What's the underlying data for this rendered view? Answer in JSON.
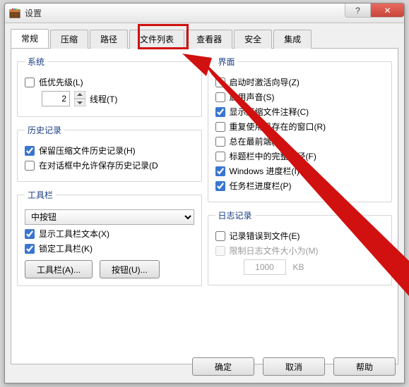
{
  "window": {
    "title": "设置"
  },
  "tabs": {
    "items": [
      "常规",
      "压缩",
      "路径",
      "文件列表",
      "查看器",
      "安全",
      "集成"
    ],
    "selected_index": 0,
    "highlight_index": 3
  },
  "left": {
    "system": {
      "legend": "系统",
      "low_priority": {
        "label": "低优先级(L)",
        "checked": false
      },
      "threads": {
        "label": "线程(T)",
        "value": "2"
      }
    },
    "history": {
      "legend": "历史记录",
      "keep_archive_history": {
        "label": "保留压缩文件历史记录(H)",
        "checked": true
      },
      "allow_dialog_history": {
        "label": "在对话框中允许保存历史记录(D",
        "checked": false
      }
    },
    "toolbar": {
      "legend": "工具栏",
      "size_select": {
        "selected": "中按钮"
      },
      "show_text": {
        "label": "显示工具栏文本(X)",
        "checked": true
      },
      "lock_toolbar": {
        "label": "锁定工具栏(K)",
        "checked": true
      },
      "toolbar_btn": "工具栏(A)...",
      "buttons_btn": "按钮(U)..."
    }
  },
  "right": {
    "interface": {
      "legend": "界面",
      "activate_wizard": {
        "label": "启动时激活向导(Z)",
        "checked": false
      },
      "enable_sound": {
        "label": "启用声音(S)",
        "checked": false
      },
      "show_comment": {
        "label": "显示压缩文件注释(C)",
        "checked": true
      },
      "reuse_window": {
        "label": "重复使用已存在的窗口(R)",
        "checked": false
      },
      "always_on_top": {
        "label": "总在最前端(W)",
        "checked": false
      },
      "full_path_title": {
        "label": "标题栏中的完整路径(F)",
        "checked": false
      },
      "windows_progress": {
        "label": "Windows 进度栏(I)",
        "checked": true
      },
      "taskbar_progress": {
        "label": "任务栏进度栏(P)",
        "checked": true
      }
    },
    "log": {
      "legend": "日志记录",
      "log_errors": {
        "label": "记录错误到文件(E)",
        "checked": false
      },
      "limit_log": {
        "label": "限制日志文件大小为(M)",
        "checked": false,
        "disabled": true
      },
      "size_value": "1000",
      "size_unit": "KB"
    }
  },
  "buttons": {
    "ok": "确定",
    "cancel": "取消",
    "help": "帮助"
  },
  "win_controls": {
    "help_glyph": "?",
    "close_glyph": "✕"
  }
}
